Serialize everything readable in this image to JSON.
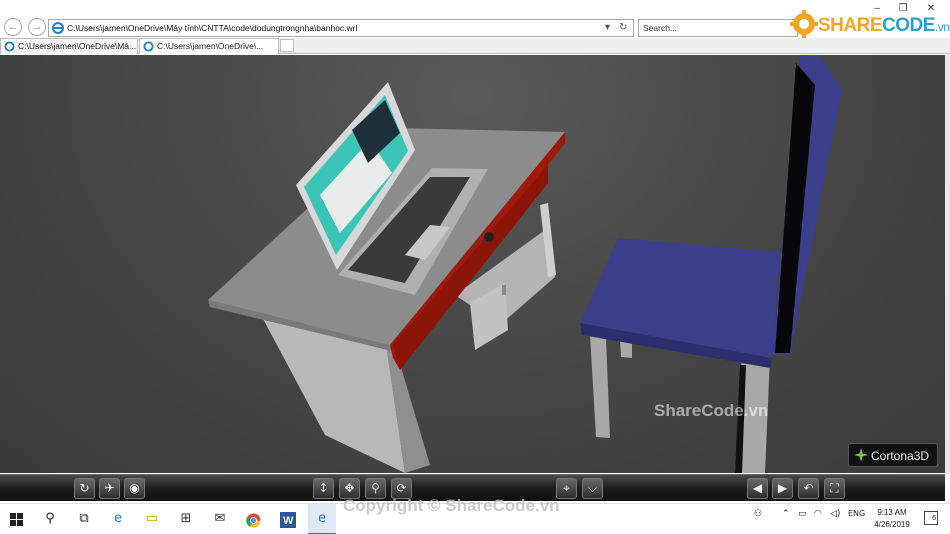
{
  "browser": {
    "address": "C:\\Users\\jamen\\OneDrive\\Máy tính\\CNTTA\\code\\dodungtrongnha\\banhoc.wrl",
    "search_placeholder": "Search...",
    "tabs": [
      {
        "label": "C:\\Users\\jamen\\OneDrive\\Má..."
      },
      {
        "label": "C:\\Users\\jamen\\OneDrive\\..."
      }
    ],
    "window_controls": {
      "minimize": "–",
      "restore": "❐",
      "close": "✕"
    }
  },
  "logo": {
    "part1": "SHARE",
    "part2": "CODE",
    "suffix": ".vn"
  },
  "viewer": {
    "brand": "Cortona3D",
    "watermark": "ShareCode.vn",
    "toolbar_left": [
      "rotate",
      "fly",
      "view"
    ],
    "toolbar_center": [
      "slide",
      "pan",
      "walk",
      "study"
    ],
    "toolbar_right": [
      "align",
      "restore"
    ],
    "toolbar_nav": [
      "prev-viewpoint",
      "next-viewpoint",
      "undo",
      "fit"
    ]
  },
  "taskbar": {
    "watermark": "Copyright © ShareCode.vn",
    "lang": "ENG",
    "time": "9:13 AM",
    "date": "4/26/2019",
    "notification_count": "6"
  },
  "colors": {
    "desk_top": "#8c8c8c",
    "desk_front": "#9e1a0a",
    "chair": "#3b3f8c",
    "legs": "#a8a8a8",
    "logo_orange": "#f2a623",
    "logo_blue": "#2aa0d0"
  }
}
